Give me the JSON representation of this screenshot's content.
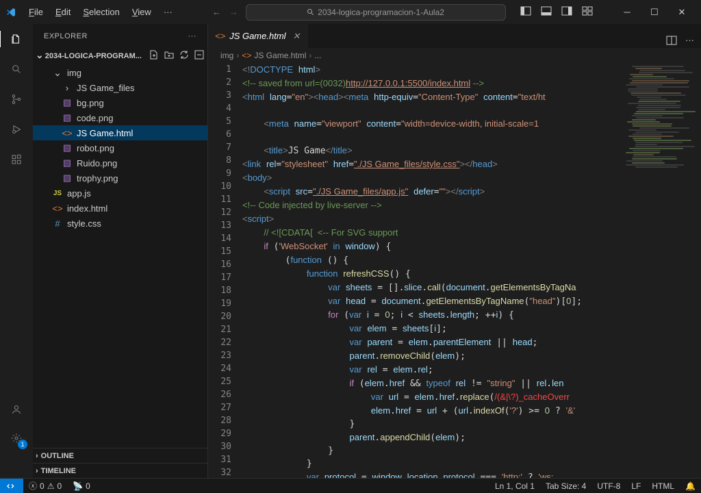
{
  "titlebar": {
    "menu": [
      "File",
      "Edit",
      "Selection",
      "View"
    ],
    "search": "2034-logica-programacion-1-Aula2"
  },
  "sidebar": {
    "title": "EXPLORER",
    "project": "2034-LOGICA-PROGRAM...",
    "tree": [
      {
        "t": "f",
        "i": 1,
        "icon": "chev-d",
        "label": "img",
        "open": true
      },
      {
        "t": "f",
        "i": 2,
        "icon": "chev-r",
        "label": "JS Game_files"
      },
      {
        "t": "file",
        "i": 2,
        "icon": "img",
        "label": "bg.png"
      },
      {
        "t": "file",
        "i": 2,
        "icon": "img",
        "label": "code.png"
      },
      {
        "t": "file",
        "i": 2,
        "icon": "html",
        "label": "JS Game.html",
        "sel": true
      },
      {
        "t": "file",
        "i": 2,
        "icon": "img",
        "label": "robot.png"
      },
      {
        "t": "file",
        "i": 2,
        "icon": "img",
        "label": "Ruido.png"
      },
      {
        "t": "file",
        "i": 2,
        "icon": "img",
        "label": "trophy.png"
      },
      {
        "t": "file",
        "i": 1,
        "icon": "js",
        "label": "app.js"
      },
      {
        "t": "file",
        "i": 1,
        "icon": "html",
        "label": "index.html"
      },
      {
        "t": "file",
        "i": 1,
        "icon": "css",
        "label": "style.css"
      }
    ],
    "outline": "OUTLINE",
    "timeline": "TIMELINE"
  },
  "tab": {
    "name": "JS Game.html"
  },
  "breadcrumb": {
    "p1": "img",
    "p2": "JS Game.html",
    "p3": "..."
  },
  "code_lines": 32,
  "statusbar": {
    "errors": "0",
    "warnings": "0",
    "port": "0",
    "ln": "Ln 1, Col 1",
    "spaces": "Tab Size: 4",
    "enc": "UTF-8",
    "eol": "LF",
    "lang": "HTML"
  }
}
